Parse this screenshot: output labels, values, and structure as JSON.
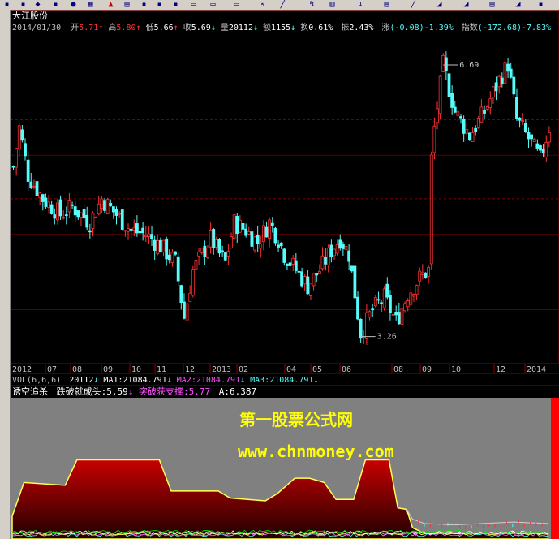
{
  "stock": {
    "name": "大江股份",
    "quote": {
      "date": "2014/01/30",
      "open_label": "开",
      "open": "5.71",
      "high_label": "高",
      "high": "5.80",
      "low_label": "低",
      "low": "5.66",
      "close_label": "收",
      "close": "5.69",
      "vol_label": "量",
      "vol": "20112",
      "amount_label": "额",
      "amount": "1155",
      "turnover_label": "换",
      "turnover": "0.61%",
      "amplitude_label": "振",
      "amplitude": "2.43%",
      "change_label": "涨",
      "change": "(-0.08)-1.39%",
      "index_label": "指数",
      "index": "(-172.68)-7.83%"
    }
  },
  "watermark": {
    "line1": "第一股票公式网",
    "line2": "www.chnmoney.com"
  },
  "vol_panel": {
    "name": "VOL(6,6,6)",
    "vol": "20112",
    "ma1": "MA1:21084.791",
    "ma2": "MA2:21084.791",
    "ma3": "MA3:21084.791"
  },
  "indicator_panel": {
    "name": "诱空追杀",
    "label1": "跌破就成头:5.59",
    "label2": "突破获支撑:5.77",
    "label3": "A:6.387"
  },
  "colors": {
    "up": "#ff3232",
    "down": "#54fcfc",
    "yellow": "#ffff54",
    "magenta": "#ff54ff",
    "green": "#00e600",
    "grid": "#8b0000",
    "gray_bg": "#808080"
  },
  "chart_data": {
    "type": "candlestick",
    "price_ylim": [
      3.0,
      7.1
    ],
    "max_marker": {
      "label": "6.69",
      "value": 6.69
    },
    "min_marker": {
      "label": "3.26",
      "value": 3.26
    },
    "x_tick_labels": [
      "2012",
      "07",
      "08",
      "09",
      "10",
      "11",
      "12",
      "2013",
      "02",
      "04",
      "05",
      "06",
      "08",
      "09",
      "10",
      "12",
      "2014"
    ],
    "price_path": [
      [
        0,
        5.4
      ],
      [
        2,
        5.9
      ],
      [
        5,
        5.3
      ],
      [
        10,
        5.0
      ],
      [
        16,
        4.8
      ],
      [
        20,
        4.9
      ],
      [
        26,
        4.7
      ],
      [
        30,
        5.0
      ],
      [
        35,
        4.8
      ],
      [
        40,
        4.6
      ],
      [
        45,
        4.55
      ],
      [
        50,
        4.4
      ],
      [
        55,
        4.2
      ],
      [
        58,
        3.5
      ],
      [
        61,
        4.1
      ],
      [
        64,
        4.3
      ],
      [
        67,
        4.5
      ],
      [
        70,
        4.3
      ],
      [
        72,
        4.2
      ],
      [
        75,
        4.7
      ],
      [
        79,
        4.6
      ],
      [
        83,
        4.45
      ],
      [
        87,
        4.7
      ],
      [
        90,
        4.5
      ],
      [
        92,
        4.3
      ],
      [
        96,
        4.1
      ],
      [
        100,
        3.9
      ],
      [
        104,
        4.1
      ],
      [
        108,
        4.35
      ],
      [
        111,
        4.5
      ],
      [
        114,
        4.3
      ],
      [
        118,
        3.3
      ],
      [
        122,
        3.6
      ],
      [
        126,
        3.75
      ],
      [
        130,
        3.45
      ],
      [
        134,
        3.8
      ],
      [
        138,
        4.0
      ],
      [
        141,
        4.1
      ],
      [
        142,
        5.5
      ],
      [
        143,
        5.9
      ],
      [
        146,
        6.69
      ],
      [
        150,
        6.1
      ],
      [
        155,
        5.8
      ],
      [
        160,
        6.1
      ],
      [
        165,
        6.5
      ],
      [
        168,
        6.7
      ],
      [
        171,
        6.0
      ],
      [
        176,
        5.7
      ],
      [
        179,
        5.5
      ],
      [
        182,
        5.9
      ]
    ],
    "indicator_ylim": [
      0,
      1
    ],
    "indicator_red_path": [
      [
        0,
        0.16
      ],
      [
        4,
        0.4
      ],
      [
        18,
        0.38
      ],
      [
        22,
        0.56
      ],
      [
        50,
        0.56
      ],
      [
        54,
        0.34
      ],
      [
        70,
        0.34
      ],
      [
        74,
        0.29
      ],
      [
        80,
        0.28
      ],
      [
        86,
        0.27
      ],
      [
        90,
        0.32
      ],
      [
        96,
        0.43
      ],
      [
        101,
        0.43
      ],
      [
        106,
        0.4
      ],
      [
        110,
        0.28
      ],
      [
        116,
        0.28
      ],
      [
        120,
        0.56
      ],
      [
        128,
        0.56
      ],
      [
        131,
        0.22
      ],
      [
        134,
        0.21
      ],
      [
        136,
        0.08
      ],
      [
        138,
        0.06
      ],
      [
        140,
        0.04
      ],
      [
        182,
        0.04
      ]
    ],
    "indicator_gray_top_path": [
      [
        0,
        0.16
      ],
      [
        4,
        0.4
      ],
      [
        18,
        0.38
      ],
      [
        22,
        0.56
      ],
      [
        50,
        0.56
      ],
      [
        54,
        0.34
      ],
      [
        70,
        0.34
      ],
      [
        74,
        0.29
      ],
      [
        80,
        0.28
      ],
      [
        86,
        0.27
      ],
      [
        90,
        0.32
      ],
      [
        96,
        0.43
      ],
      [
        101,
        0.43
      ],
      [
        106,
        0.4
      ],
      [
        110,
        0.28
      ],
      [
        116,
        0.28
      ],
      [
        120,
        0.56
      ],
      [
        128,
        0.56
      ],
      [
        131,
        0.22
      ],
      [
        134,
        0.21
      ],
      [
        136,
        0.14
      ],
      [
        140,
        0.11
      ],
      [
        150,
        0.1
      ],
      [
        160,
        0.11
      ],
      [
        170,
        0.12
      ],
      [
        182,
        0.11
      ]
    ]
  }
}
